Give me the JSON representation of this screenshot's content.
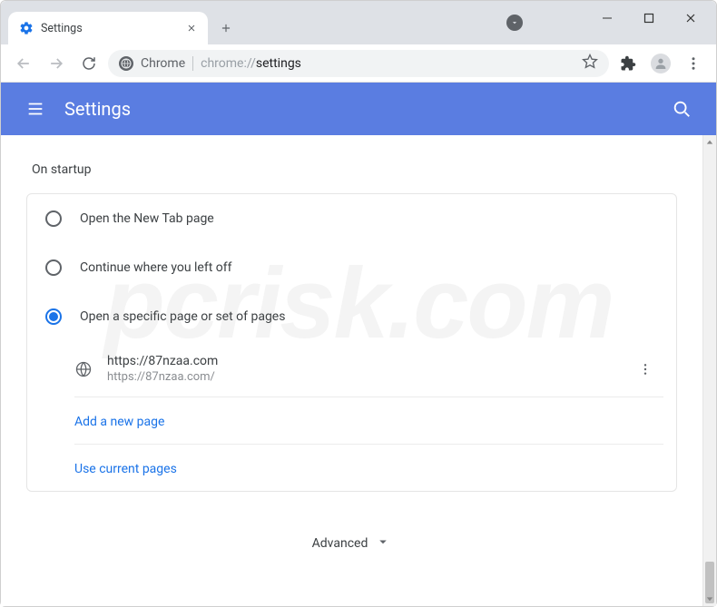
{
  "window": {
    "tab_title": "Settings",
    "url_prefix": "Chrome",
    "url_path_dim": "chrome://",
    "url_path": "settings"
  },
  "bluebar": {
    "title": "Settings"
  },
  "section": {
    "title": "On startup"
  },
  "radios": {
    "new_tab": "Open the New Tab page",
    "continue": "Continue where you left off",
    "specific": "Open a specific page or set of pages"
  },
  "page": {
    "title": "https://87nzaa.com",
    "url": "https://87nzaa.com/"
  },
  "links": {
    "add": "Add a new page",
    "use_current": "Use current pages"
  },
  "footer": {
    "advanced": "Advanced"
  },
  "watermark": "pcrisk.com"
}
